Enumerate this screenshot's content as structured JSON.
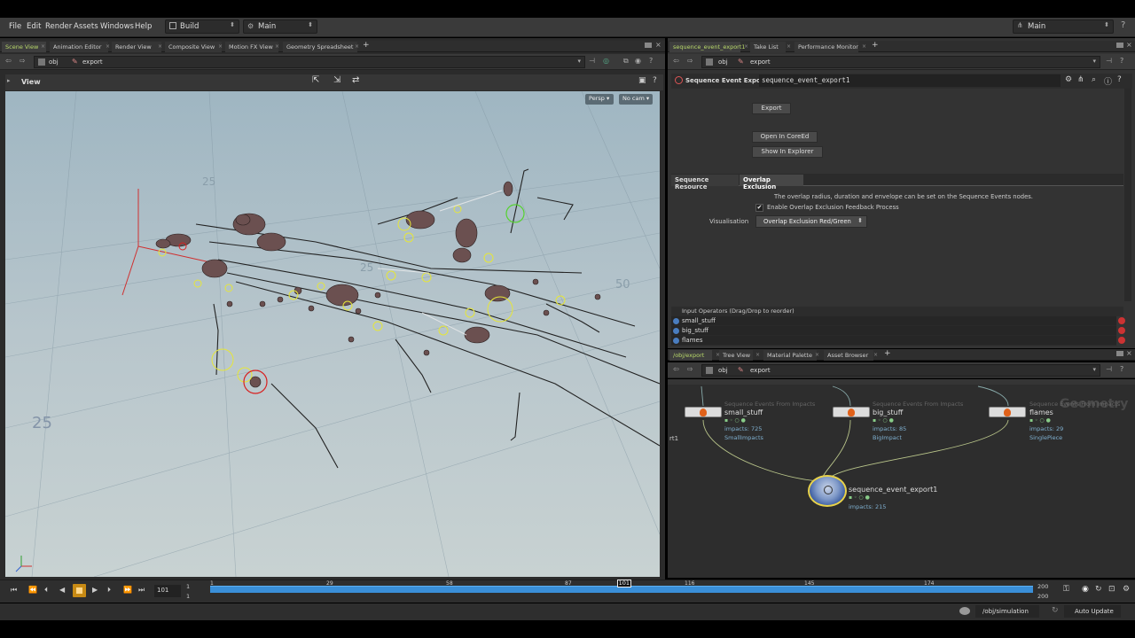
{
  "menu": {
    "items": [
      "File",
      "Edit",
      "Render",
      "Assets",
      "Windows",
      "Help"
    ],
    "desktop": "Build",
    "main_left": "Main",
    "main_right": "Main"
  },
  "left_tabs": [
    "Scene View",
    "Animation Editor",
    "Render View",
    "Composite View",
    "Motion FX View",
    "Geometry Spreadsheet"
  ],
  "right_tabs": [
    "sequence_event_export1",
    "Take List",
    "Performance Monitor"
  ],
  "network_tabs": [
    "/obj/export",
    "Tree View",
    "Material Palette",
    "Asset Browser"
  ],
  "path": {
    "root": "obj",
    "node": "export"
  },
  "viewport": {
    "title": "View",
    "persp": "Persp",
    "cam": "No cam",
    "grid_labels": [
      "25",
      "50",
      "25",
      "25"
    ]
  },
  "params": {
    "type_label": "Sequence Event Export",
    "node_name": "sequence_event_export1",
    "export_btn": "Export",
    "open_btn": "Open In CoreEd",
    "show_btn": "Show In Explorer",
    "tabs": [
      "Sequence Resource",
      "Overlap Exclusion"
    ],
    "info": "The overlap radius, duration and envelope can be set on the Sequence Events nodes.",
    "checkbox_label": "Enable Overlap Exclusion Feedback Process",
    "checkbox_checked": true,
    "vis_label": "Visualisation",
    "vis_value": "Overlap Exclusion Red/Green",
    "list_header": "Input Operators (Drag/Drop to reorder)",
    "inputs": [
      "small_stuff",
      "big_stuff",
      "flames"
    ]
  },
  "network": {
    "watermark": "Geometry",
    "edge_label": "rt1",
    "nodes": [
      {
        "type": "Sequence Events From Impacts",
        "name": "small_stuff",
        "impacts": "impacts: 725",
        "sub": "SmallImpacts"
      },
      {
        "type": "Sequence Events From Impacts",
        "name": "big_stuff",
        "impacts": "impacts: 85",
        "sub": "BigImpact"
      },
      {
        "type": "Sequence Events From Impacts",
        "name": "flames",
        "impacts": "impacts: 29",
        "sub": "SinglePiece"
      }
    ],
    "output": {
      "name": "sequence_event_export1",
      "impacts": "impacts: 215"
    }
  },
  "timeline": {
    "frame": "101",
    "start_top": "1",
    "start_bot": "1",
    "ticks": [
      "1",
      "29",
      "58",
      "87",
      "101",
      "116",
      "145",
      "174"
    ],
    "end_top": "200",
    "end_bot": "200",
    "current_marker": "101",
    "current_fraction": 0.503
  },
  "status": {
    "path": "/obj/simulation",
    "update": "Auto Update"
  },
  "colors": {
    "accent": "#b8d86a",
    "timeline": "#3a8fd8",
    "viewport_top": "#9fb6c2",
    "viewport_bottom": "#c8d2d2"
  }
}
